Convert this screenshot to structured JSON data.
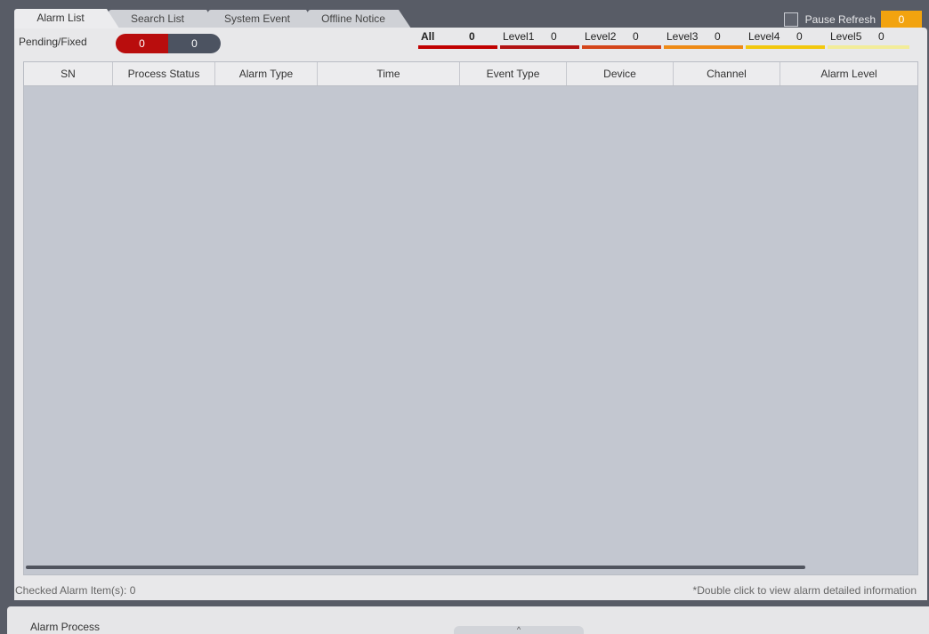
{
  "tabs": [
    {
      "label": "Alarm List",
      "active": true
    },
    {
      "label": "Search List",
      "active": false
    },
    {
      "label": "System Event",
      "active": false
    },
    {
      "label": "Offline Notice",
      "active": false
    }
  ],
  "pause": {
    "label": "Pause Refresh",
    "count": "0",
    "checked": false
  },
  "filter": {
    "pending_label": "Pending/Fixed",
    "pending_count": "0",
    "fixed_count": "0",
    "levels": [
      {
        "label": "All",
        "count": "0",
        "color": "#c00000"
      },
      {
        "label": "Level1",
        "count": "0",
        "color": "#b21212"
      },
      {
        "label": "Level2",
        "count": "0",
        "color": "#d4451a"
      },
      {
        "label": "Level3",
        "count": "0",
        "color": "#ee8a16"
      },
      {
        "label": "Level4",
        "count": "0",
        "color": "#f2c80e"
      },
      {
        "label": "Level5",
        "count": "0",
        "color": "#f2ec9a"
      }
    ]
  },
  "table": {
    "columns": [
      "SN",
      "Process Status",
      "Alarm Type",
      "Time",
      "Event Type",
      "Device",
      "Channel",
      "Alarm Level"
    ],
    "rows": []
  },
  "footer": {
    "checked_label": "Checked Alarm Item(s): 0",
    "hint": "*Double click to view alarm detailed information"
  },
  "bottom": {
    "process_label": "Alarm Process",
    "expand_icon": "chevron-up-icon"
  }
}
